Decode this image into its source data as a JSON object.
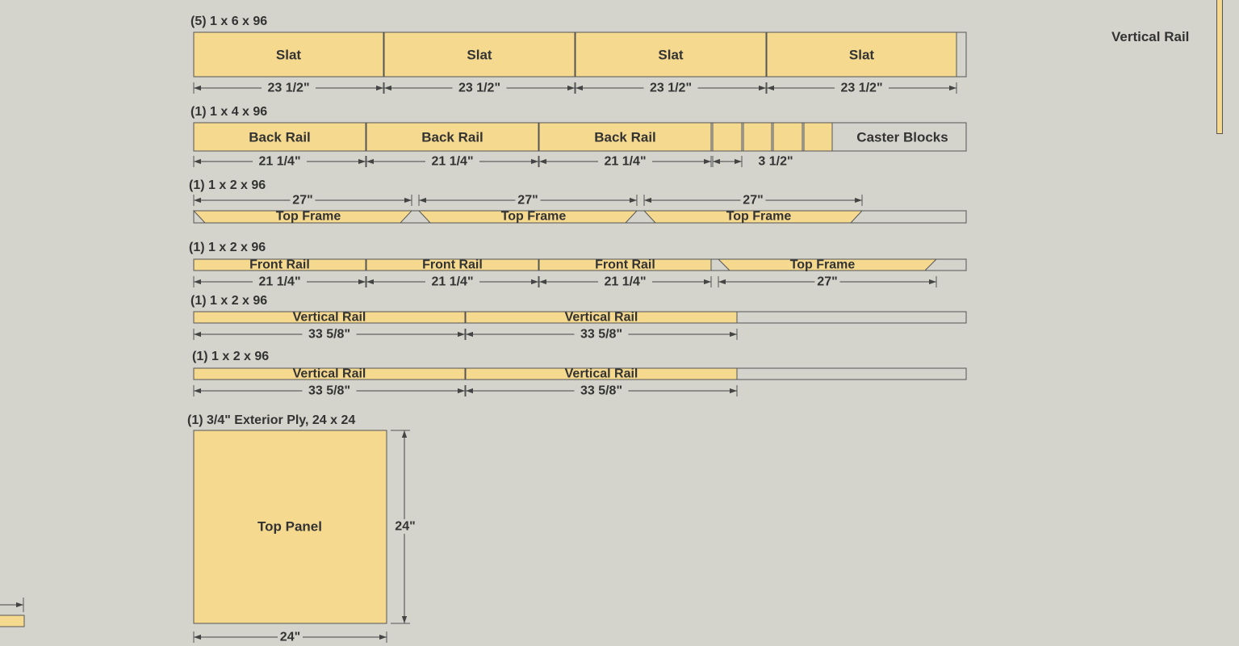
{
  "side_label": "Vertical Rail",
  "colors": {
    "background": "#d4d4cc",
    "board": "#d4d4cc",
    "piece": "#f5d98f",
    "line": "#555555",
    "text": "#333333"
  },
  "boards": [
    {
      "header": "(5) 1 x 6 x 96",
      "pieces": [
        {
          "label": "Slat",
          "dim": "23 1/2\""
        },
        {
          "label": "Slat",
          "dim": "23 1/2\""
        },
        {
          "label": "Slat",
          "dim": "23 1/2\""
        },
        {
          "label": "Slat",
          "dim": "23 1/2\""
        }
      ]
    },
    {
      "header": "(1) 1 x 4 x 96",
      "pieces": [
        {
          "label": "Back Rail",
          "dim": "21 1/4\""
        },
        {
          "label": "Back Rail",
          "dim": "21 1/4\""
        },
        {
          "label": "Back Rail",
          "dim": "21 1/4\""
        },
        {
          "label": "",
          "dim": "3 1/2\""
        },
        {
          "label": "",
          "dim": ""
        },
        {
          "label": "",
          "dim": ""
        },
        {
          "label": "",
          "dim": ""
        }
      ],
      "group_label": "Caster Blocks"
    },
    {
      "header": "(1) 1 x 2 x 96",
      "pieces": [
        {
          "label": "Top Frame",
          "dim": "27\""
        },
        {
          "label": "Top Frame",
          "dim": "27\""
        },
        {
          "label": "Top Frame",
          "dim": "27\""
        }
      ]
    },
    {
      "header": "(1) 1 x 2 x 96",
      "pieces": [
        {
          "label": "Front Rail",
          "dim": "21 1/4\""
        },
        {
          "label": "Front Rail",
          "dim": "21 1/4\""
        },
        {
          "label": "Front Rail",
          "dim": "21 1/4\""
        },
        {
          "label": "Top Frame",
          "dim": "27\""
        }
      ]
    },
    {
      "header": "(1) 1 x 2 x 96",
      "pieces": [
        {
          "label": "Vertical Rail",
          "dim": "33 5/8\""
        },
        {
          "label": "Vertical Rail",
          "dim": "33 5/8\""
        }
      ]
    },
    {
      "header": "(1) 1 x 2 x 96",
      "pieces": [
        {
          "label": "Vertical Rail",
          "dim": "33 5/8\""
        },
        {
          "label": "Vertical Rail",
          "dim": "33 5/8\""
        }
      ]
    }
  ],
  "panel": {
    "header": "(1) 3/4\" Exterior Ply, 24 x 24",
    "label": "Top Panel",
    "width_dim": "24\"",
    "height_dim": "24\""
  }
}
